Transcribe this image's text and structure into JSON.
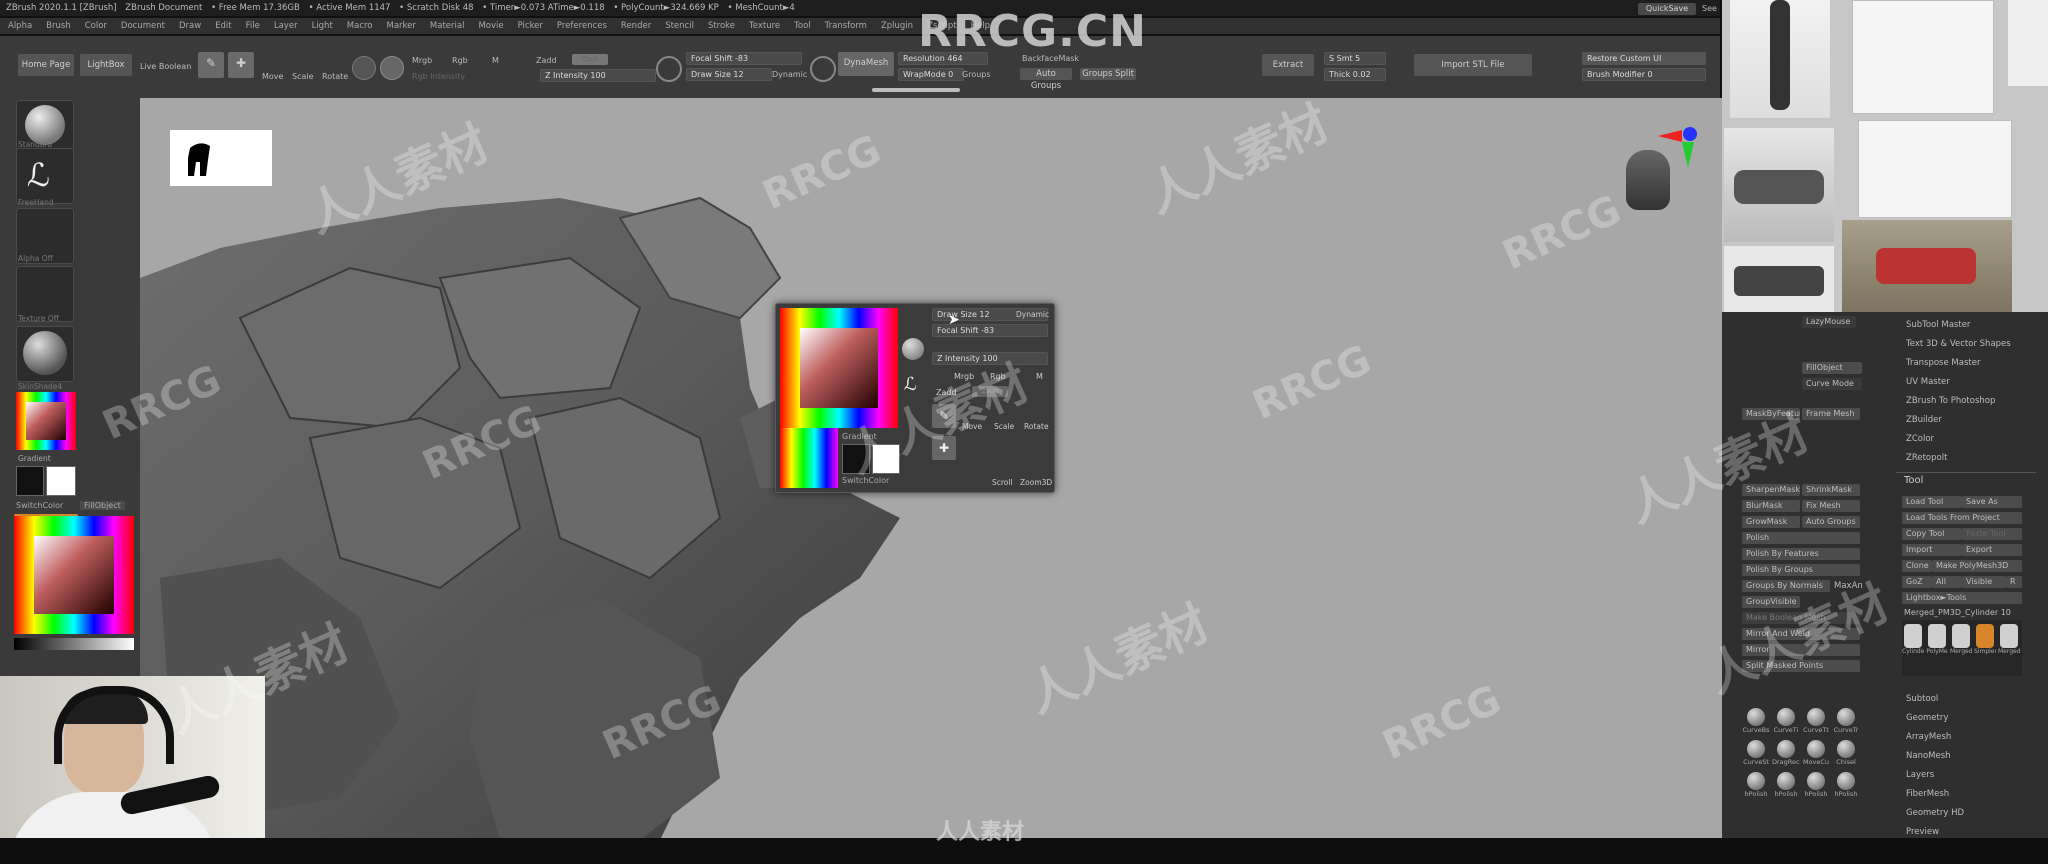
{
  "titlebar": {
    "app": "ZBrush 2020.1.1 [ZBrush]",
    "document": "ZBrush Document",
    "free_mem": "• Free Mem 17.36GB",
    "active_mem": "• Active Mem 1147",
    "scratch_disk": "• Scratch Disk 48",
    "timer": "• Timer►0.073 ATime►0.118",
    "polycount": "• PolyCount►324.669 KP",
    "meshcount": "• MeshCount►4",
    "quicksave": "QuickSave",
    "see": "See"
  },
  "watermark_logo": "RRCG.CN",
  "watermarks": [
    "人人素材",
    "RRCG"
  ],
  "menu": [
    "Alpha",
    "Brush",
    "Color",
    "Document",
    "Draw",
    "Edit",
    "File",
    "Layer",
    "Light",
    "Macro",
    "Marker",
    "Material",
    "Movie",
    "Picker",
    "Preferences",
    "Render",
    "Stencil",
    "Stroke",
    "Texture",
    "Tool",
    "Transform",
    "Zplugin",
    "Zscript",
    "Help"
  ],
  "toolbar": {
    "home_page": "Home Page",
    "lightbox": "LightBox",
    "live_boolean": "Live Boolean",
    "edit": "Edit",
    "draw": "Draw",
    "move": "Move",
    "scale": "Scale",
    "rotate": "Rotate",
    "mrgb": "Mrgb",
    "rgb": "Rgb",
    "m": "M",
    "zadd": "Zadd",
    "zsub": "Zsub",
    "rgb_intensity": "Rgb Intensity",
    "z_intensity": "Z Intensity 100",
    "focal_shift": "Focal Shift -83",
    "draw_size": "Draw Size 12",
    "dynamic": "Dynamic",
    "dynamesh": "DynaMesh",
    "resolution": "Resolution 464",
    "wrapmode": "WrapMode 0",
    "groups": "Groups",
    "backfacemask": "BackfaceMask",
    "auto_groups": "Auto Groups",
    "groups_split": "Groups Split",
    "extract": "Extract",
    "s_smt": "S Smt 5",
    "thick": "Thick 0.02",
    "import_stl": "Import STL File",
    "restore_custom_ui": "Restore Custom UI",
    "brush_modifier": "Brush Modifier 0"
  },
  "left_shelf": {
    "standard": "Standard",
    "freehand": "FreeHand",
    "alpha_off": "Alpha Off",
    "texture_off": "Texture Off",
    "material": "SkinShade4",
    "gradient": "Gradient",
    "switch_color": "SwitchColor",
    "fill_object": "FillObject"
  },
  "color_popup": {
    "draw_size": "Draw Size 12",
    "focal_shift": "Focal Shift -83",
    "dynamic": "Dynamic",
    "z_intensity": "Z Intensity 100",
    "mrgb": "Mrgb",
    "rgb": "Rgb",
    "m": "M",
    "zadd": "Zadd",
    "zsub": "Zsub",
    "gradient": "Gradient",
    "switch_color": "SwitchColor",
    "standard": "Standard",
    "freehand": "FreeHand",
    "alpha_off": "Alpha Off",
    "texture_off": "Texture Off",
    "edit": "Edit",
    "draw": "Draw",
    "move": "Move",
    "scale": "Scale",
    "rotate": "Rotate",
    "scroll": "Scroll",
    "zoom3d": "Zoom3D"
  },
  "right_panel": {
    "lazymouse": "LazyMouse",
    "fill_object": "FillObject",
    "curve_mode": "Curve Mode",
    "mask_by_feature": "MaskByFeature",
    "frame_mesh": "Frame Mesh",
    "sharpen_mask": "SharpenMask",
    "shrink_mask": "ShrinkMask",
    "blur_mask": "BlurMask",
    "fix_mesh": "Fix Mesh",
    "grow_mask": "GrowMask",
    "auto_groups": "Auto Groups",
    "polish": "Polish",
    "polish_by_features": "Polish By Features",
    "polish_by_groups": "Polish By Groups",
    "groups_by_normals": "Groups By Normals",
    "maxangle": "MaxAn",
    "group_visible": "GroupVisible",
    "make_boolean_mesh": "Make Boolean Mesh",
    "mirror_and_weld": "Mirror And Weld",
    "mirror": "Mirror",
    "split_masked_points": "Split Masked Points",
    "brushes": [
      "CurveBs",
      "CurveTi",
      "CurveTt",
      "CurveTr",
      "CurveSt",
      "DragRect",
      "MoveCu",
      "Chisel",
      "hPolish",
      "hPolish",
      "hPolish",
      "hPolish"
    ],
    "plugins": [
      "SubTool Master",
      "Text 3D & Vector Shapes",
      "Transpose Master",
      "UV Master",
      "ZBrush To Photoshop",
      "ZBuilder",
      "ZColor",
      "ZRetopolt"
    ],
    "tool_header": "Tool",
    "load_tool": "Load Tool",
    "save_as": "Save As",
    "load_from_project": "Load Tools From Project",
    "copy_tool": "Copy Tool",
    "paste_tool": "Paste Tool",
    "import": "Import",
    "export": "Export",
    "clone": "Clone",
    "make_polymesh": "Make PolyMesh3D",
    "goz": "GoZ",
    "all": "All",
    "visible": "Visible",
    "r": "R",
    "lightbox_tools": "Lightbox►Tools",
    "current_tool": "Merged_PM3D_Cylinder 10",
    "subtool_thumbs": [
      "Cylinde",
      "PolyMe",
      "Merged_PM3D",
      "Simpler",
      "Merged"
    ],
    "tool_sections": [
      "Subtool",
      "Geometry",
      "ArrayMesh",
      "NanoMesh",
      "Layers",
      "FiberMesh",
      "Geometry HD",
      "Preview"
    ]
  },
  "colors": {
    "viewport_bg": "#a7a7a7",
    "ui_dark": "#3a3a3a",
    "accent_orange": "#d8852a"
  }
}
